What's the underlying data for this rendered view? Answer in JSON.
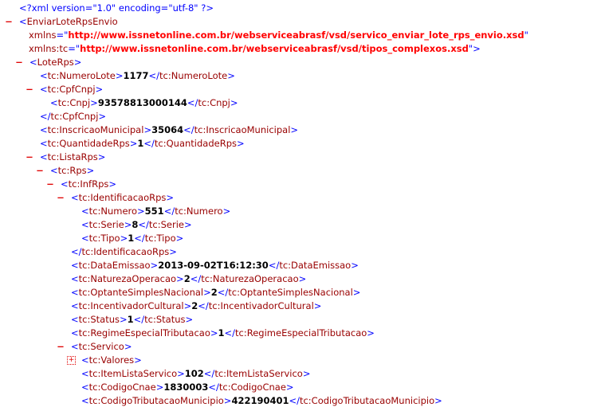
{
  "document": {
    "declaration": "<?xml version=\"1.0\" encoding=\"utf-8\" ?>",
    "root_name": "EnviarLoteRpsEnvio",
    "root_attributes": [
      {
        "name": "xmlns",
        "value": "http://www.issnetonline.com.br/webserviceabrasf/vsd/servico_enviar_lote_rps_envio.xsd"
      },
      {
        "name": "xmlns:tc",
        "value": "http://www.issnetonline.com.br/webserviceabrasf/vsd/tipos_complexos.xsd"
      }
    ],
    "lines": [
      {
        "indent": 1,
        "kind": "open",
        "toggle": "−",
        "name": "LoteRps"
      },
      {
        "indent": 2,
        "kind": "leaf",
        "name": "tc:NumeroLote",
        "value": "1177"
      },
      {
        "indent": 2,
        "kind": "open",
        "toggle": "−",
        "name": "tc:CpfCnpj"
      },
      {
        "indent": 3,
        "kind": "leaf",
        "name": "tc:Cnpj",
        "value": "93578813000144"
      },
      {
        "indent": 2,
        "kind": "close",
        "name": "tc:CpfCnpj"
      },
      {
        "indent": 2,
        "kind": "leaf",
        "name": "tc:InscricaoMunicipal",
        "value": "35064"
      },
      {
        "indent": 2,
        "kind": "leaf",
        "name": "tc:QuantidadeRps",
        "value": "1"
      },
      {
        "indent": 2,
        "kind": "open",
        "toggle": "−",
        "name": "tc:ListaRps"
      },
      {
        "indent": 3,
        "kind": "open",
        "toggle": "−",
        "name": "tc:Rps"
      },
      {
        "indent": 4,
        "kind": "open",
        "toggle": "−",
        "name": "tc:InfRps"
      },
      {
        "indent": 5,
        "kind": "open",
        "toggle": "−",
        "name": "tc:IdentificacaoRps"
      },
      {
        "indent": 6,
        "kind": "leaf",
        "name": "tc:Numero",
        "value": "551"
      },
      {
        "indent": 6,
        "kind": "leaf",
        "name": "tc:Serie",
        "value": "8"
      },
      {
        "indent": 6,
        "kind": "leaf",
        "name": "tc:Tipo",
        "value": "1"
      },
      {
        "indent": 5,
        "kind": "close",
        "name": "tc:IdentificacaoRps"
      },
      {
        "indent": 5,
        "kind": "leaf",
        "name": "tc:DataEmissao",
        "value": "2013-09-02T16:12:30"
      },
      {
        "indent": 5,
        "kind": "leaf",
        "name": "tc:NaturezaOperacao",
        "value": "2"
      },
      {
        "indent": 5,
        "kind": "leaf",
        "name": "tc:OptanteSimplesNacional",
        "value": "2"
      },
      {
        "indent": 5,
        "kind": "leaf",
        "name": "tc:IncentivadorCultural",
        "value": "2"
      },
      {
        "indent": 5,
        "kind": "leaf",
        "name": "tc:Status",
        "value": "1"
      },
      {
        "indent": 5,
        "kind": "leaf",
        "name": "tc:RegimeEspecialTributacao",
        "value": "1"
      },
      {
        "indent": 5,
        "kind": "open",
        "toggle": "−",
        "name": "tc:Servico"
      },
      {
        "indent": 6,
        "kind": "open",
        "toggle": "+",
        "name": "tc:Valores"
      },
      {
        "indent": 6,
        "kind": "leaf",
        "name": "tc:ItemListaServico",
        "value": "102"
      },
      {
        "indent": 6,
        "kind": "leaf",
        "name": "tc:CodigoCnae",
        "value": "1830003"
      },
      {
        "indent": 6,
        "kind": "leaf",
        "name": "tc:CodigoTributacaoMunicipio",
        "value": "422190401"
      }
    ]
  },
  "colors": {
    "markup_blue": "#0000ff",
    "tag_name": "#990000",
    "attribute_value": "#ff0000",
    "toggle": "#e00000",
    "text_value": "#000000"
  }
}
